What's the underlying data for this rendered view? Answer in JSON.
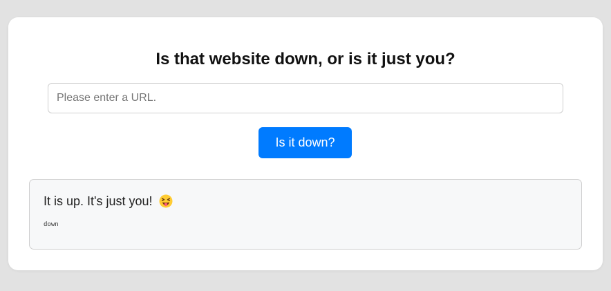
{
  "page": {
    "heading": "Is that website down, or is it just you?"
  },
  "form": {
    "url_placeholder": "Please enter a URL.",
    "url_value": "",
    "submit_label": "Is it down?"
  },
  "result": {
    "message": "It is up. It's just you!",
    "emoji_icon": "squinting-face-with-tongue-icon",
    "status_text": "down"
  },
  "colors": {
    "accent": "#007bff",
    "page_background": "#e2e2e2",
    "card_background": "#ffffff",
    "result_background": "#f7f8f9"
  }
}
